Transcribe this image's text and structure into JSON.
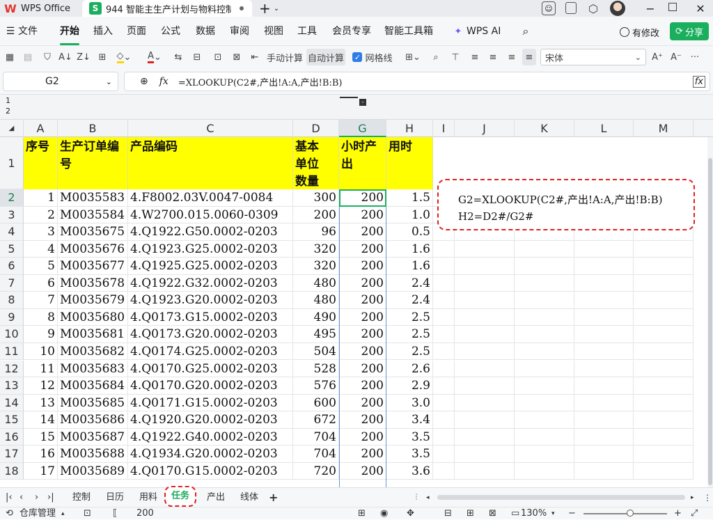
{
  "window": {
    "app_name": "WPS Office",
    "doc_tab_title": "944 智能主生产计划与物料控制",
    "new_tab_symbol": "+"
  },
  "menu": {
    "items": [
      "文件",
      "开始",
      "插入",
      "页面",
      "公式",
      "数据",
      "审阅",
      "视图",
      "工具",
      "会员专享",
      "智能工具箱",
      "WPS AI"
    ],
    "active": "开始",
    "modified_label": "有修改",
    "share_label": "分享"
  },
  "toolbar": {
    "manual_calc": "手动计算",
    "auto_calc": "自动计算",
    "gridlines_label": "网格线",
    "gridlines_checked": true,
    "font_name": "宋体",
    "more": "···"
  },
  "formula_bar": {
    "name_box": "G2",
    "fx": "fx",
    "formula": "=XLOOKUP(C2#,产出!A:A,产出!B:B)"
  },
  "outline": {
    "levels": [
      "1",
      "2"
    ]
  },
  "columns": [
    {
      "letter": "A",
      "selected": false
    },
    {
      "letter": "B",
      "selected": false
    },
    {
      "letter": "C",
      "selected": false
    },
    {
      "letter": "D",
      "selected": false
    },
    {
      "letter": "G",
      "selected": true
    },
    {
      "letter": "H",
      "selected": false
    },
    {
      "letter": "I",
      "selected": false
    },
    {
      "letter": "J",
      "selected": false
    },
    {
      "letter": "K",
      "selected": false
    },
    {
      "letter": "L",
      "selected": false
    },
    {
      "letter": "M",
      "selected": false
    }
  ],
  "header_row": {
    "row_number": "1",
    "seq": "序号",
    "order": "生产订单编号",
    "product": "产品编码",
    "qty": "基本单位数量",
    "per_hour": "小时产出",
    "hours": "用时"
  },
  "rows": [
    {
      "n": "2",
      "seq": "1",
      "order": "M0035583",
      "product": "4.F8002.03V.0047-0084",
      "qty": "300",
      "per_hour": "200",
      "hours": "1.5"
    },
    {
      "n": "3",
      "seq": "2",
      "order": "M0035584",
      "product": "4.W2700.015.0060-0309",
      "qty": "200",
      "per_hour": "200",
      "hours": "1.0"
    },
    {
      "n": "4",
      "seq": "3",
      "order": "M0035675",
      "product": "4.Q1922.G50.0002-0203",
      "qty": "96",
      "per_hour": "200",
      "hours": "0.5"
    },
    {
      "n": "5",
      "seq": "4",
      "order": "M0035676",
      "product": "4.Q1923.G25.0002-0203",
      "qty": "320",
      "per_hour": "200",
      "hours": "1.6"
    },
    {
      "n": "6",
      "seq": "5",
      "order": "M0035677",
      "product": "4.Q1925.G25.0002-0203",
      "qty": "320",
      "per_hour": "200",
      "hours": "1.6"
    },
    {
      "n": "7",
      "seq": "6",
      "order": "M0035678",
      "product": "4.Q1922.G32.0002-0203",
      "qty": "480",
      "per_hour": "200",
      "hours": "2.4"
    },
    {
      "n": "8",
      "seq": "7",
      "order": "M0035679",
      "product": "4.Q1923.G20.0002-0203",
      "qty": "480",
      "per_hour": "200",
      "hours": "2.4"
    },
    {
      "n": "9",
      "seq": "8",
      "order": "M0035680",
      "product": "4.Q0173.G15.0002-0203",
      "qty": "490",
      "per_hour": "200",
      "hours": "2.5"
    },
    {
      "n": "10",
      "seq": "9",
      "order": "M0035681",
      "product": "4.Q0173.G20.0002-0203",
      "qty": "495",
      "per_hour": "200",
      "hours": "2.5"
    },
    {
      "n": "11",
      "seq": "10",
      "order": "M0035682",
      "product": "4.Q0174.G25.0002-0203",
      "qty": "504",
      "per_hour": "200",
      "hours": "2.5"
    },
    {
      "n": "12",
      "seq": "11",
      "order": "M0035683",
      "product": "4.Q0170.G25.0002-0203",
      "qty": "528",
      "per_hour": "200",
      "hours": "2.6"
    },
    {
      "n": "13",
      "seq": "12",
      "order": "M0035684",
      "product": "4.Q0170.G20.0002-0203",
      "qty": "576",
      "per_hour": "200",
      "hours": "2.9"
    },
    {
      "n": "14",
      "seq": "13",
      "order": "M0035685",
      "product": "4.Q0171.G15.0002-0203",
      "qty": "600",
      "per_hour": "200",
      "hours": "3.0"
    },
    {
      "n": "15",
      "seq": "14",
      "order": "M0035686",
      "product": "4.Q1920.G20.0002-0203",
      "qty": "672",
      "per_hour": "200",
      "hours": "3.4"
    },
    {
      "n": "16",
      "seq": "15",
      "order": "M0035687",
      "product": "4.Q1922.G40.0002-0203",
      "qty": "704",
      "per_hour": "200",
      "hours": "3.5"
    },
    {
      "n": "17",
      "seq": "16",
      "order": "M0035688",
      "product": "4.Q1934.G20.0002-0203",
      "qty": "704",
      "per_hour": "200",
      "hours": "3.5"
    },
    {
      "n": "18",
      "seq": "17",
      "order": "M0035689",
      "product": "4.Q0170.G15.0002-0203",
      "qty": "720",
      "per_hour": "200",
      "hours": "3.6"
    }
  ],
  "note_box": {
    "line1": "G2=XLOOKUP(C2#,产出!A:A,产出!B:B)",
    "line2": "H2=D2#/G2#",
    "border_color": "#e02020"
  },
  "sheet_tabs": {
    "items": [
      "控制",
      "日历",
      "用料",
      "任务",
      "产出",
      "线体"
    ],
    "active": "任务",
    "add": "+"
  },
  "status": {
    "left_label": "仓库管理",
    "cell_value": "200",
    "zoom": "130%"
  },
  "colors": {
    "accent_green": "#1aaf5d",
    "header_fill": "#ffff00",
    "note_border": "#e02020"
  }
}
